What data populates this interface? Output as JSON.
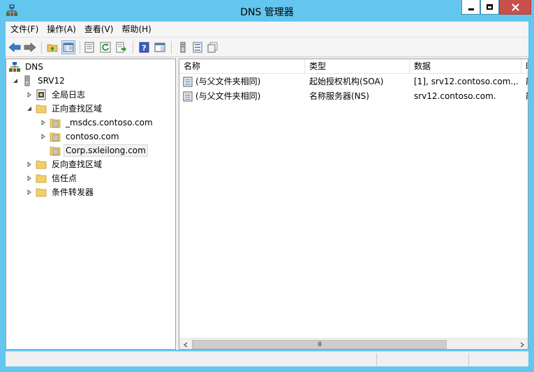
{
  "window": {
    "title": "DNS 管理器"
  },
  "menu": [
    "文件(F)",
    "操作(A)",
    "查看(V)",
    "帮助(H)"
  ],
  "toolbar": {
    "buttons": [
      "back-icon",
      "forward-icon",
      "up-folder-icon",
      "show-tree-icon",
      "properties-icon",
      "refresh-icon",
      "export-icon",
      "help-icon",
      "console-icon",
      "server-icon",
      "list-icon",
      "copy-icon"
    ]
  },
  "tree": {
    "root": "DNS",
    "server": "SRV12",
    "global_logs": "全局日志",
    "forward_zones": "正向查找区域",
    "zones": [
      "_msdcs.contoso.com",
      "contoso.com",
      "Corp.sxleilong.com"
    ],
    "reverse_zones": "反向查找区域",
    "trust_points": "信任点",
    "conditional_forwarders": "条件转发器"
  },
  "list": {
    "columns": [
      "名称",
      "类型",
      "数据",
      "时"
    ],
    "rows": [
      {
        "name": "(与父文件夹相同)",
        "type": "起始授权机构(SOA)",
        "data": "[1], srv12.contoso.com.,...",
        "ts": "静"
      },
      {
        "name": "(与父文件夹相同)",
        "type": "名称服务器(NS)",
        "data": "srv12.contoso.com.",
        "ts": "静"
      }
    ]
  },
  "scrollbar": {
    "grip": "III"
  },
  "colors": {
    "titlebar": "#63c6ee",
    "close_button": "#c7504a",
    "selection": "#d9e9f7"
  }
}
